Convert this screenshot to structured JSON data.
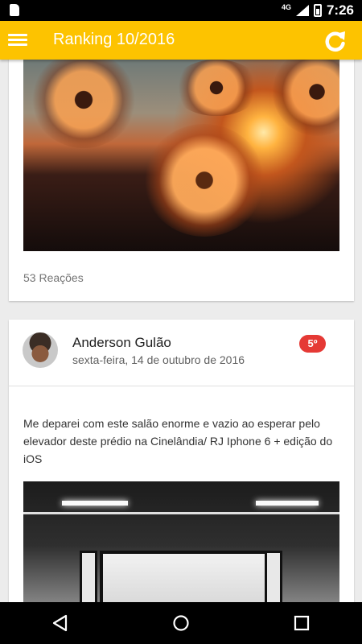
{
  "status_bar": {
    "time": "7:26",
    "network": "4G"
  },
  "app_bar": {
    "title": "Ranking 10/2016",
    "accent_color": "#fdc300",
    "menu_icon": "hamburger-menu-icon",
    "refresh_icon": "refresh-icon"
  },
  "feed": {
    "posts": [
      {
        "reactions": "53 Reações"
      },
      {
        "author": "Anderson Gulão",
        "date": "sexta-feira, 14 de outubro de 2016",
        "rank": "5º",
        "rank_color": "#e53935",
        "text": "Me deparei com este salão enorme e vazio ao esperar pelo elevador deste prédio na Cinelândia/ RJ Iphone 6 + edição do iOS"
      }
    ]
  },
  "nav_bar": {
    "back_icon": "back-icon",
    "home_icon": "home-icon",
    "recents_icon": "recents-icon"
  }
}
